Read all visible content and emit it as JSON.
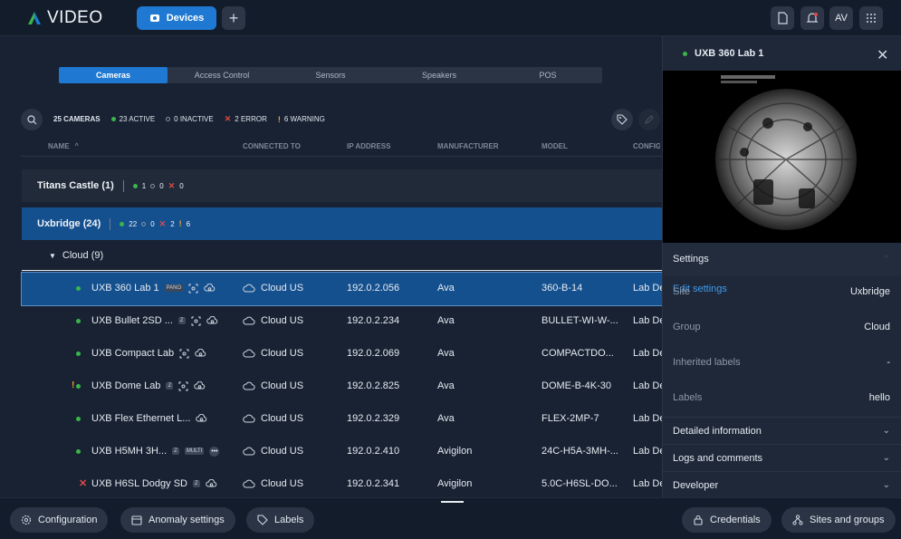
{
  "app": {
    "logo_text": "VIDEO",
    "avatar": "AV"
  },
  "topbar": {
    "devices_label": "Devices",
    "icons": [
      "document-icon",
      "bell-icon",
      "grid-icon"
    ]
  },
  "subtabs": [
    "Cameras",
    "Access Control",
    "Sensors",
    "Speakers",
    "POS"
  ],
  "summary": {
    "total": "25 CAMERAS",
    "active": "23 ACTIVE",
    "inactive": "0 INACTIVE",
    "error": "2 ERROR",
    "warning": "6 WARNING"
  },
  "columns": {
    "name": "NAME",
    "connected_to": "CONNECTED TO",
    "ip_address": "IP ADDRESS",
    "manufacturer": "MANUFACTURER",
    "model": "MODEL",
    "config": "CONFIG"
  },
  "groups": {
    "titans": {
      "label": "Titans Castle (1)",
      "active": "1",
      "inactive": "0",
      "error": "0"
    },
    "uxbridge": {
      "label": "Uxbridge (24)",
      "active": "22",
      "inactive": "0",
      "error": "2",
      "warning": "6"
    }
  },
  "cloud": {
    "label": "Cloud (9)"
  },
  "cameras": [
    {
      "name": "UXB 360 Lab 1",
      "badge": "PANO",
      "connected": "Cloud US",
      "ip": "192.0.2.056",
      "manufacturer": "Ava",
      "model": "360-B-14",
      "config": "Lab De"
    },
    {
      "name": "UXB Bullet 2SD ...",
      "badge": "Z",
      "connected": "Cloud US",
      "ip": "192.0.2.234",
      "manufacturer": "Ava",
      "model": "BULLET-WI-W-...",
      "config": "Lab De"
    },
    {
      "name": "UXB Compact Lab",
      "badge": "",
      "connected": "Cloud US",
      "ip": "192.0.2.069",
      "manufacturer": "Ava",
      "model": "COMPACTDO...",
      "config": "Lab De"
    },
    {
      "name": "UXB Dome Lab",
      "badge": "Z",
      "connected": "Cloud US",
      "ip": "192.0.2.825",
      "manufacturer": "Ava",
      "model": "DOME-B-4K-30",
      "config": "Lab De"
    },
    {
      "name": "UXB Flex Ethernet L...",
      "badge": "",
      "connected": "Cloud US",
      "ip": "192.0.2.329",
      "manufacturer": "Ava",
      "model": "FLEX-2MP-7",
      "config": "Lab De"
    },
    {
      "name": "UXB H5MH 3H...",
      "badge": "Z",
      "badge2": "MULTI",
      "connected": "Cloud US",
      "ip": "192.0.2.410",
      "manufacturer": "Avigilon",
      "model": "24C-H5A-3MH-...",
      "config": "Lab De"
    },
    {
      "name": "UXB H6SL Dodgy SD",
      "badge": "Z",
      "connected": "Cloud US",
      "ip": "192.0.2.341",
      "manufacturer": "Avigilon",
      "model": "5.0C-H6SL-DO...",
      "config": "Lab De"
    }
  ],
  "panel": {
    "title": "UXB 360 Lab 1",
    "settings": "Settings",
    "edit_settings": "Edit settings",
    "fields": [
      {
        "key": "Site",
        "value": "Uxbridge"
      },
      {
        "key": "Group",
        "value": "Cloud"
      },
      {
        "key": "Inherited labels",
        "value": "-"
      },
      {
        "key": "Labels",
        "value": "hello"
      }
    ],
    "sections": [
      "Detailed information",
      "Logs and comments",
      "Developer"
    ]
  },
  "bottombar": {
    "configuration": "Configuration",
    "anomaly": "Anomaly settings",
    "labels": "Labels",
    "credentials": "Credentials",
    "sites": "Sites and groups"
  },
  "colors": {
    "accent": "#1f78d1",
    "selected_row": "#15508e",
    "active": "#3ab54a",
    "error": "#e04848",
    "warning": "#f0a030"
  }
}
